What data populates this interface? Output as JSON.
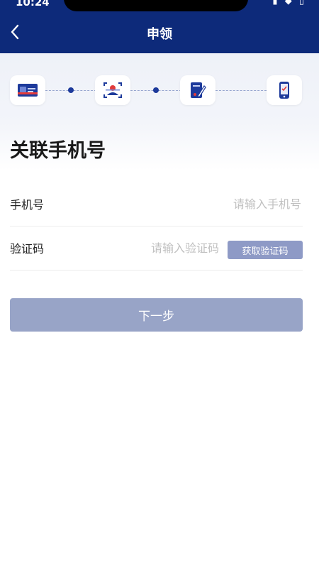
{
  "status_bar": {
    "time": "10:24",
    "icons": "▮ ◆ ▯"
  },
  "header": {
    "title": "申领",
    "back_icon": "chevron-left-icon"
  },
  "stepper": {
    "steps": [
      {
        "icon": "id-card-icon"
      },
      {
        "icon": "face-scan-icon"
      },
      {
        "icon": "document-sign-icon"
      },
      {
        "icon": "phone-check-icon"
      }
    ],
    "current_step": 1
  },
  "page": {
    "heading": "关联手机号"
  },
  "form": {
    "phone": {
      "label": "手机号",
      "placeholder": "请输入手机号",
      "value": ""
    },
    "code": {
      "label": "验证码",
      "placeholder": "请输入验证码",
      "value": "",
      "button_label": "获取验证码"
    }
  },
  "actions": {
    "next_label": "下一步"
  },
  "colors": {
    "header_bg": "#0d2a7a",
    "accent": "#1d3a9b",
    "button_disabled": "#98a4c7",
    "code_button": "#8e9ac6"
  }
}
